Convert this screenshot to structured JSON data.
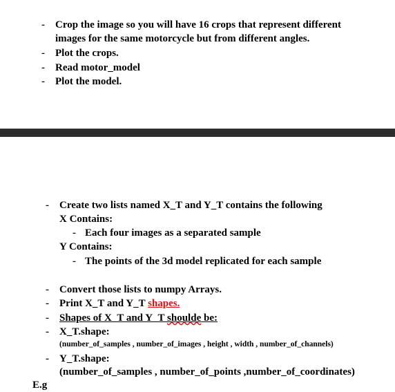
{
  "section1": {
    "items": [
      "Crop the image so you will have 16 crops that represent different",
      "images for the same motorcycle but from different angles.",
      "Plot the crops.",
      "Read motor_model",
      "Plot the model."
    ]
  },
  "section2": {
    "intro": "Create two lists named X_T and Y_T contains the following",
    "x_heading": "X Contains:",
    "x_item": "Each four images as a separated sample",
    "y_heading": "Y Contains:",
    "y_item": "The points of the 3d model replicated for each sample",
    "convert": "Convert those lists to numpy Arrays.",
    "print_prefix": "Print X_T and Y_T ",
    "print_link": "shapes.",
    "shapes_prefix": "Shapes of X_T and Y_T ",
    "shapes_word": "shoulde",
    "shapes_suffix": " be:",
    "xt_label": "X_T.shape:",
    "xt_value": "(number_of_samples , number_of_images , height , width , number_of_channels)",
    "yt_label": "Y_T.shape:",
    "yt_value": "(number_of_samples , number_of_points ,number_of_coordinates)",
    "eg": "E.g"
  },
  "colors": {
    "divider": "#2d2d2d",
    "link_red": "#d2161b",
    "text": "#000000"
  },
  "dash": "-"
}
